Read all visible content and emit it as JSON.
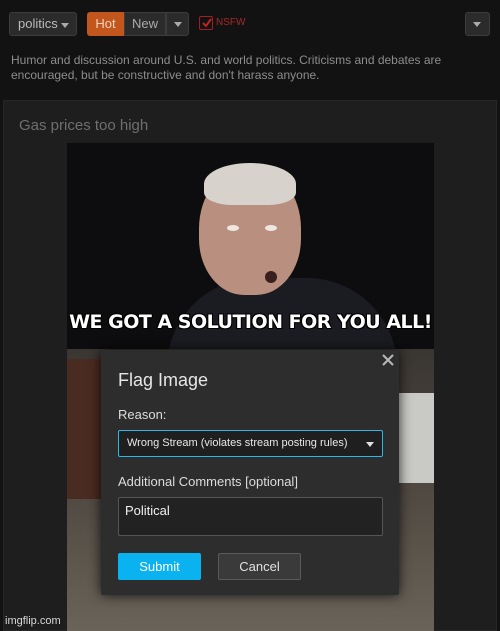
{
  "topbar": {
    "stream_label": "politics",
    "hot_label": "Hot",
    "new_label": "New",
    "nsfw_label": "NSFW",
    "nsfw_checked": true
  },
  "description": "Humor and discussion around U.S. and world politics. Criticisms and debates are encouraged, but be constructive and don't harass anyone.",
  "post": {
    "title": "Gas prices too high",
    "image_caption": "WE GOT A SOLUTION FOR YOU ALL!"
  },
  "modal": {
    "title": "Flag Image",
    "reason_label": "Reason:",
    "reason_value": "Wrong Stream (violates stream posting rules)",
    "comments_label": "Additional Comments [optional]",
    "comments_value": "Political",
    "submit_label": "Submit",
    "cancel_label": "Cancel"
  },
  "watermark": "imgflip.com",
  "colors": {
    "accent": "#0ab3ef",
    "hot": "#c3561c",
    "nsfw": "#a82828",
    "background": "#121212"
  },
  "icons": [
    "chevron-down-icon",
    "checkmark-icon",
    "close-icon"
  ]
}
